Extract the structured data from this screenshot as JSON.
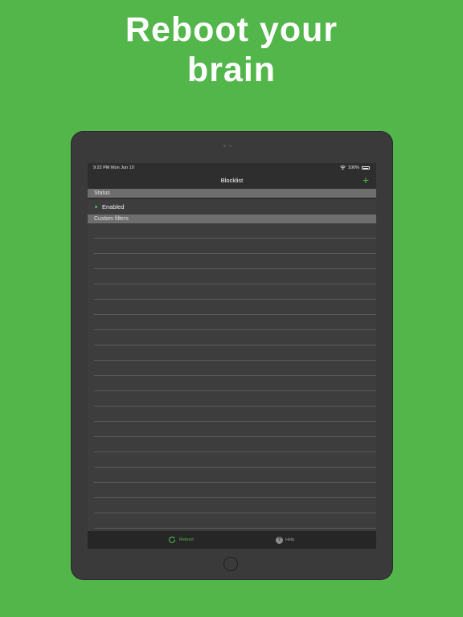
{
  "headline": {
    "line1": "Reboot your",
    "line2": "brain"
  },
  "status_bar": {
    "time": "9:22 PM   Mon Jun 10",
    "battery": "100%"
  },
  "nav": {
    "title": "Blocklist",
    "add_icon": "plus-icon",
    "add_label": "+"
  },
  "sections": {
    "status_header": "Status",
    "status_value": "Enabled",
    "filters_header": "Custom filters"
  },
  "tabs": [
    {
      "label": "Reboot",
      "icon": "reboot-icon"
    },
    {
      "label": "Help",
      "icon": "help-icon",
      "glyph": "?"
    }
  ],
  "colors": {
    "accent": "#52b64a",
    "background": "#52b64a",
    "device": "#3a3a3a"
  }
}
